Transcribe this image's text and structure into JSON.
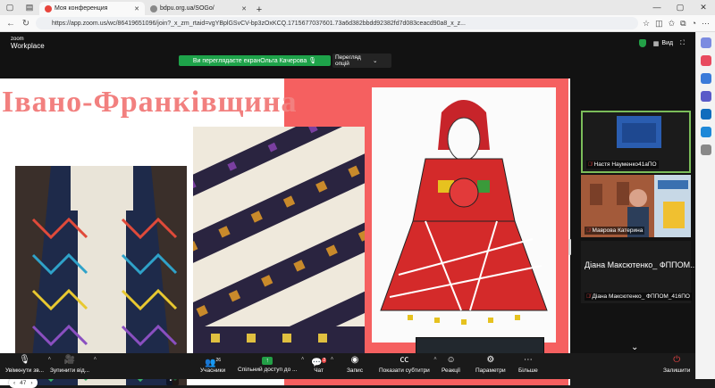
{
  "browser": {
    "tabs": [
      {
        "label": "Моя конференция",
        "active": true,
        "favicon_color": "#e8453c"
      },
      {
        "label": "bdpu.org.ua/SOGo/",
        "active": false,
        "favicon_color": "#888888"
      }
    ],
    "url": "https://app.zoom.us/wc/86419651096/join?_x_zm_rtaid=vgYBplGSvCV-bp3zOxKCQ.1715677037601.73a6d382bbdd92382fd7d083ceacd90a8_x_z...",
    "icons": [
      "back-icon",
      "refresh-icon",
      "star-icon",
      "extensions-icon",
      "favorites-icon",
      "profile-icon",
      "menu-icon"
    ]
  },
  "zoom": {
    "logo_top": "zoom",
    "logo_bottom": "Workplace",
    "banner": "Ви переглядаєте екранОльга Качерова",
    "view_options": "Перегляд опцій",
    "view_label": "Вид",
    "page_counter": "47",
    "slide": {
      "title": "Івано-Франківщина"
    },
    "participants": [
      {
        "name": "Настя Науменко41аПО",
        "muted": true,
        "active": true
      },
      {
        "name": "Маврова Катерина",
        "muted": true,
        "active": false
      },
      {
        "name": "Діана Максютенко_ ФППОМ_416ПО",
        "display_name": "Діана Максютенко_ ФППОМ...",
        "muted": true,
        "active": false
      }
    ],
    "toolbar": {
      "unmute": "Увімкнути зв...",
      "stop_video": "Зупинити від...",
      "participants": "Учасники",
      "participants_count": "26",
      "share": "Спільний доступ до ...",
      "chat": "Чат",
      "chat_badge": "2",
      "record": "Запис",
      "captions": "Показати субтитри",
      "reactions": "Реакції",
      "settings": "Параметри",
      "more": "Більше",
      "leave": "Залишити"
    }
  },
  "colors": {
    "accent_green": "#1ea34a",
    "slide_pink": "#f56060",
    "title_pink": "#f2807f",
    "active_border": "#7bbd5a"
  }
}
